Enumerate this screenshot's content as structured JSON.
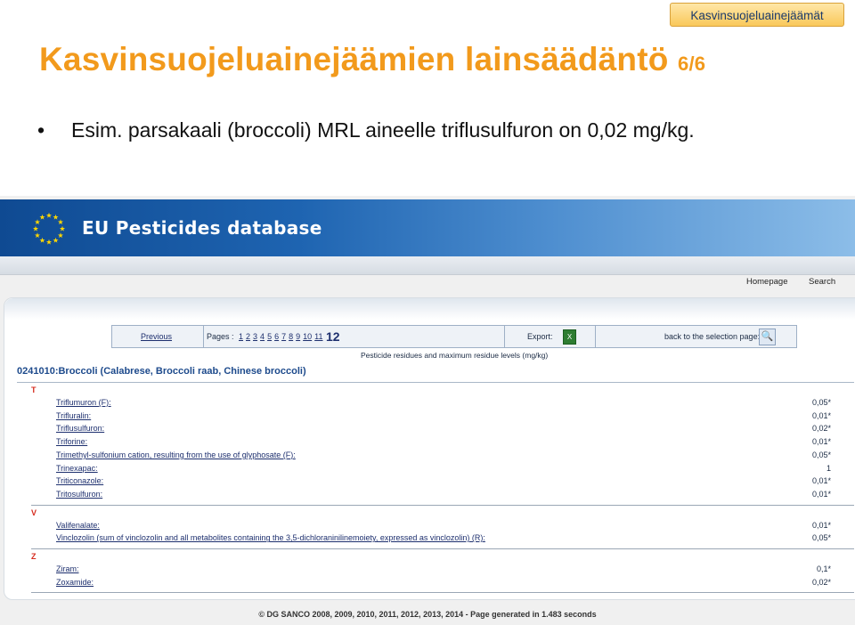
{
  "slide": {
    "badge": "Kasvinsuojeluainejäämät",
    "title": "Kasvinsuojeluainejäämien lainsäädäntö",
    "title_page": "6/6",
    "bullet": "Esim. parsakaali (broccoli) MRL aineelle triflusulfuron on 0,02 mg/kg."
  },
  "app": {
    "banner_title": "EU Pesticides database",
    "nav": {
      "homepage": "Homepage",
      "search": "Search"
    },
    "pager": {
      "previous": "Previous",
      "pages_label": "Pages :",
      "pages": [
        "1",
        "2",
        "3",
        "4",
        "5",
        "6",
        "7",
        "8",
        "9",
        "10",
        "11"
      ],
      "current": "12",
      "export": "Export:",
      "back": "back to the selection page:"
    },
    "subheading": "Pesticide residues and maximum residue levels (mg/kg)",
    "product": "0241010:Broccoli (Calabrese, Broccoli raab, Chinese broccoli)",
    "groups": [
      {
        "letter": "T",
        "rows": [
          {
            "name": "Triflumuron (F)",
            "value": "0,05*"
          },
          {
            "name": "Trifluralin",
            "value": "0,01*"
          },
          {
            "name": "Triflusulfuron",
            "value": "0,02*"
          },
          {
            "name": "Triforine",
            "value": "0,01*"
          },
          {
            "name": "Trimethyl-sulfonium cation, resulting from the use of glyphosate (F)",
            "value": "0,05*"
          },
          {
            "name": "Trinexapac",
            "value": "1"
          },
          {
            "name": "Triticonazole",
            "value": "0,01*"
          },
          {
            "name": "Tritosulfuron",
            "value": "0,01*"
          }
        ]
      },
      {
        "letter": "V",
        "rows": [
          {
            "name": "Valifenalate",
            "value": "0,01*"
          },
          {
            "name": "Vinclozolin (sum of vinclozolin and all metabolites containing the 3,5-dichloraninilinemoiety, expressed as vinclozolin) (R)",
            "value": "0,05*"
          }
        ]
      },
      {
        "letter": "Z",
        "rows": [
          {
            "name": "Ziram",
            "value": "0,1*"
          },
          {
            "name": "Zoxamide",
            "value": "0,02*"
          }
        ]
      }
    ],
    "footer": "© DG SANCO 2008, 2009, 2010, 2011, 2012, 2013, 2014 - Page generated in 1.483 seconds"
  }
}
